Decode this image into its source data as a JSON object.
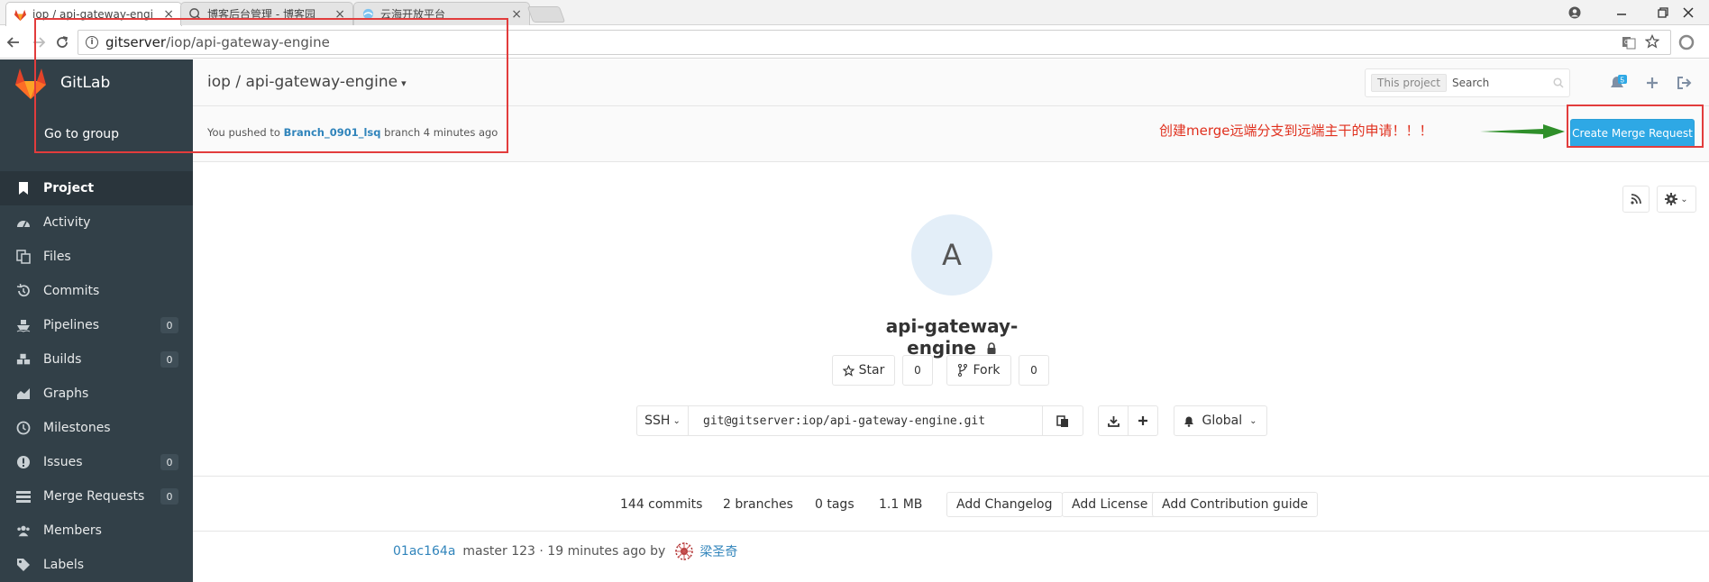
{
  "browser": {
    "tabs": [
      {
        "title": "iop / api-gateway-engi",
        "active": true
      },
      {
        "title": "博客后台管理 - 博客园",
        "active": false
      },
      {
        "title": "云海开放平台",
        "active": false
      }
    ],
    "url_host": "gitserver",
    "url_path": "/iop/api-gateway-engine"
  },
  "sidebar": {
    "brand": "GitLab",
    "go_to_group": "Go to group",
    "items": [
      {
        "label": "Project",
        "icon": "bookmark-icon",
        "count": null,
        "active": true
      },
      {
        "label": "Activity",
        "icon": "dashboard-icon",
        "count": null
      },
      {
        "label": "Files",
        "icon": "files-icon",
        "count": null
      },
      {
        "label": "Commits",
        "icon": "history-icon",
        "count": null
      },
      {
        "label": "Pipelines",
        "icon": "ship-icon",
        "count": "0"
      },
      {
        "label": "Builds",
        "icon": "cubes-icon",
        "count": "0"
      },
      {
        "label": "Graphs",
        "icon": "area-chart-icon",
        "count": null
      },
      {
        "label": "Milestones",
        "icon": "clock-icon",
        "count": null
      },
      {
        "label": "Issues",
        "icon": "exclamation-circle-icon",
        "count": "0"
      },
      {
        "label": "Merge Requests",
        "icon": "tasks-icon",
        "count": "0"
      },
      {
        "label": "Members",
        "icon": "users-icon",
        "count": null
      },
      {
        "label": "Labels",
        "icon": "tags-icon",
        "count": null
      }
    ]
  },
  "header": {
    "breadcrumb": "iop / api-gateway-engine",
    "search_scope": "This project",
    "search_placeholder": "Search",
    "todo_count": "5"
  },
  "push_notice": {
    "prefix": "You pushed to",
    "branch": "Branch_0901_lsq",
    "suffix": "branch 4 minutes ago",
    "button": "Create Merge Request",
    "annotation": "创建merge远端分支到远端主干的申请！！！"
  },
  "project": {
    "avatar_letter": "A",
    "name": "api-gateway-engine",
    "star_label": "Star",
    "star_count": "0",
    "fork_label": "Fork",
    "fork_count": "0",
    "protocol": "SSH",
    "clone_url": "git@gitserver:iop/api-gateway-engine.git",
    "notification": "Global"
  },
  "stats": {
    "commits": "144 commits",
    "branches": "2 branches",
    "tags": "0 tags",
    "size": "1.1 MB",
    "add_changelog": "Add Changelog",
    "add_license": "Add License",
    "add_contribution": "Add Contribution guide"
  },
  "last_commit": {
    "sha": "01ac164a",
    "message": "master 123 · 19 minutes ago by",
    "author": "梁圣奇"
  },
  "colors": {
    "sidebar_bg": "#324048",
    "accent_blue": "#2ea8e5",
    "link_blue": "#3084bb",
    "annotation_red": "#e0301e",
    "arrow_green": "#2f8f2a"
  }
}
